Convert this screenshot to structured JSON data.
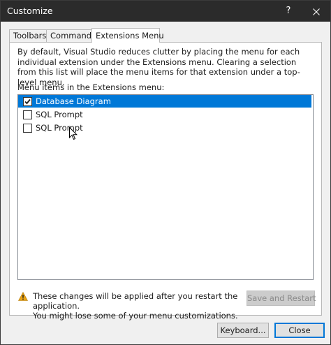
{
  "window": {
    "title": "Customize",
    "help_glyph": "?",
    "close_icon": "close-icon"
  },
  "tabs": [
    {
      "label": "Toolbars",
      "active": false
    },
    {
      "label": "Commands",
      "active": false
    },
    {
      "label": "Extensions Menu",
      "active": true
    }
  ],
  "extensions_menu": {
    "description": "By default, Visual Studio reduces clutter by placing the menu for each individual extension under the Extensions menu. Clearing a selection from this list will place the menu items for that extension under a top-level menu.",
    "list_label": "Menu items in the Extensions menu:",
    "items": [
      {
        "label": "Database Diagram",
        "checked": true,
        "selected": true
      },
      {
        "label": "SQL Prompt",
        "checked": false,
        "selected": false
      },
      {
        "label": "SQL Prompt",
        "checked": false,
        "selected": false
      }
    ],
    "warning_line1": "These changes will be applied after you restart the application.",
    "warning_line2": "You might lose some of your menu customizations.",
    "warning_icon": "warning-icon",
    "save_restart_label": "Save and Restart"
  },
  "footer": {
    "keyboard_label": "Keyboard...",
    "close_label": "Close"
  },
  "colors": {
    "selection": "#0078d7",
    "titlebar": "#2b2b2b",
    "warning": "#e8a317"
  }
}
